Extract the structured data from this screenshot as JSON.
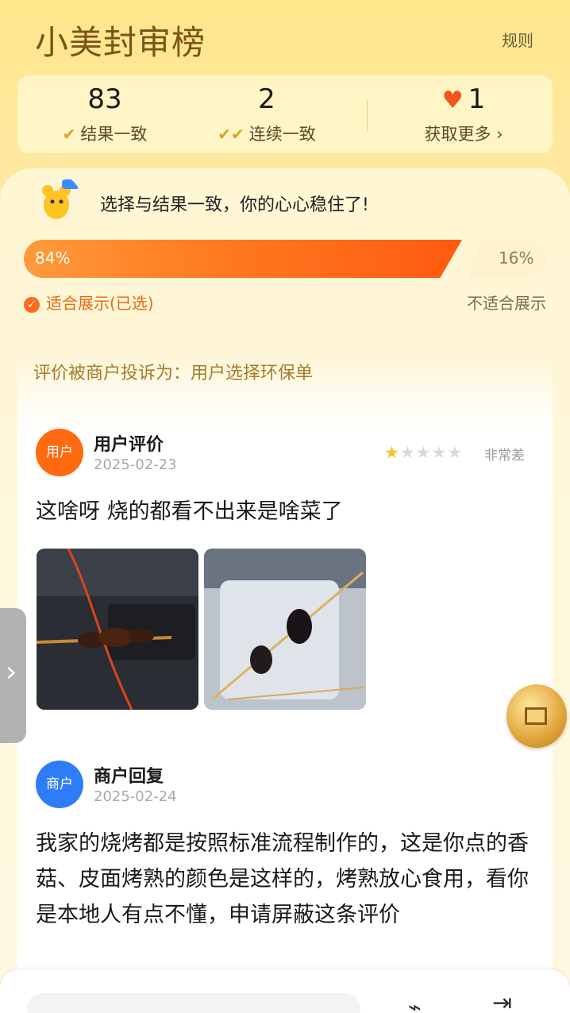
{
  "header": {
    "title": "小美封审榜",
    "rules_label": "规则"
  },
  "stats": {
    "result_match_count": "83",
    "result_match_label": "结果一致",
    "streak_count": "2",
    "streak_label": "连续一致",
    "hearts_count": "1",
    "get_more_label": "获取更多"
  },
  "vote": {
    "headline": "选择与结果一致，你的心心稳住了!",
    "suitable_percent": "84%",
    "unsuitable_percent": "16%",
    "suitable_fraction": 0.84,
    "suitable_label": "适合展示(已选)",
    "unsuitable_label": "不适合展示"
  },
  "complaint": "评价被商户投诉为：用户选择环保单",
  "review": {
    "avatar_label": "用户",
    "author": "用户评价",
    "date": "2025-02-23",
    "stars": 1,
    "stars_max": 5,
    "rating_text": "非常差",
    "text": "这啥呀 烧的都看不出来是啥菜了"
  },
  "reply": {
    "avatar_label": "商户",
    "author": "商户回复",
    "date": "2025-02-24",
    "text": "我家的烧烤都是按照标准流程制作的，这是你点的香菇、皮面烤熟的颜色是这样的，烤熟放心食用，看你是本地人有点不懂，申请屏蔽这条评价"
  },
  "colors": {
    "accent": "#ff6a10",
    "merchant": "#2f7df6",
    "gold": "#7a5418"
  },
  "icons": [
    "check-icon",
    "double-check-icon",
    "heart-icon",
    "chevron-right-icon",
    "star-icon",
    "share-icon",
    "exit-icon",
    "coin-icon",
    "side-tab-chevron-icon"
  ]
}
